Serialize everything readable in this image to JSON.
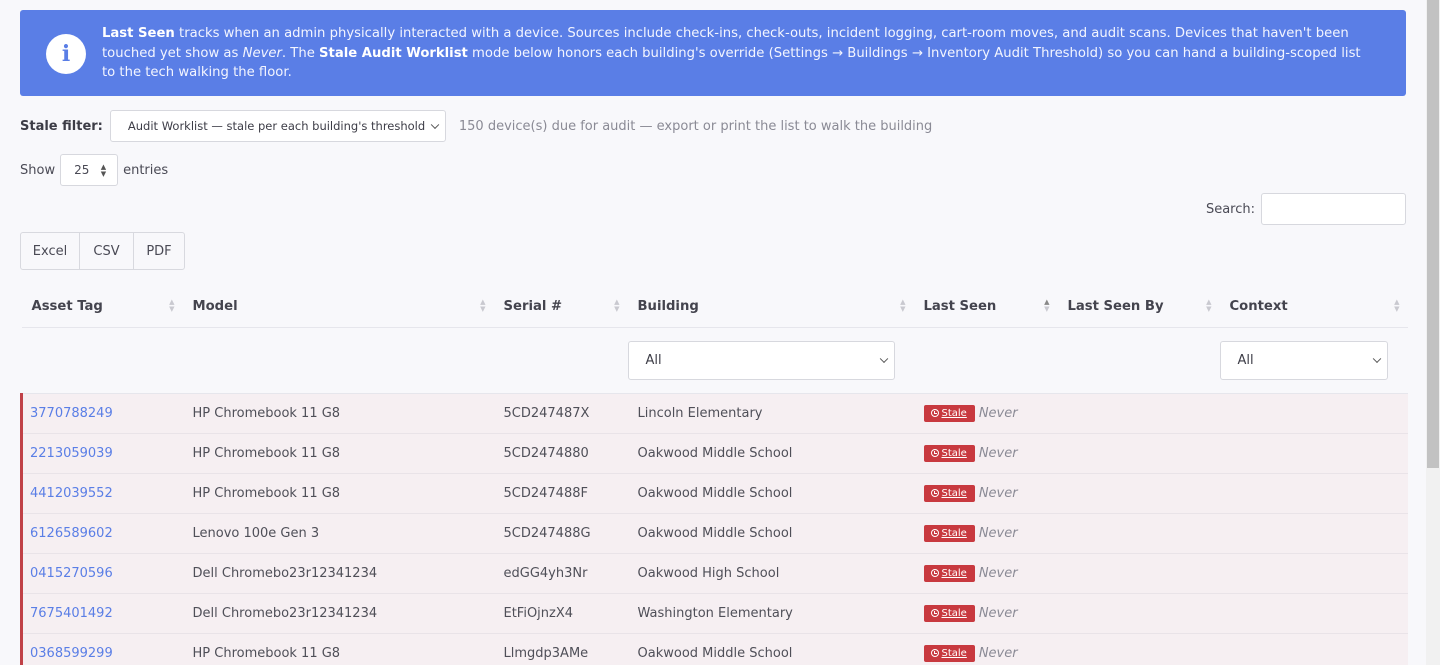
{
  "banner": {
    "icon": "info-icon",
    "bold1": "Last Seen",
    "text1": " tracks when an admin physically interacted with a device. Sources include check-ins, check-outs, incident logging, cart-room moves, and audit scans. Devices that haven't been touched yet show as ",
    "italic1": "Never",
    "text2": ". The ",
    "bold2": "Stale Audit Worklist",
    "text3": " mode below honors each building's override (Settings → Buildings → Inventory Audit Threshold) so you can hand a building-scoped list to the tech walking the floor."
  },
  "stale_filter": {
    "label": "Stale filter:",
    "selected": "Audit Worklist — stale per each building's threshold",
    "note": "150 device(s) due for audit — export or print the list to walk the building"
  },
  "length": {
    "show": "Show",
    "value": "25",
    "entries": "entries"
  },
  "search": {
    "label": "Search:"
  },
  "buttons": {
    "excel": "Excel",
    "csv": "CSV",
    "pdf": "PDF"
  },
  "table": {
    "headers": [
      "Asset Tag",
      "Model",
      "Serial #",
      "Building",
      "Last Seen",
      "Last Seen By",
      "Context"
    ],
    "building_filter": "All",
    "context_filter": "All",
    "stale_label": "Stale",
    "rows": [
      {
        "asset": "3770788249",
        "model": "HP Chromebook 11 G8",
        "serial": "5CD247487X",
        "building": "Lincoln Elementary",
        "last_seen": "Never"
      },
      {
        "asset": "2213059039",
        "model": "HP Chromebook 11 G8",
        "serial": "5CD2474880",
        "building": "Oakwood Middle School",
        "last_seen": "Never"
      },
      {
        "asset": "4412039552",
        "model": "HP Chromebook 11 G8",
        "serial": "5CD247488F",
        "building": "Oakwood Middle School",
        "last_seen": "Never"
      },
      {
        "asset": "6126589602",
        "model": "Lenovo 100e Gen 3",
        "serial": "5CD247488G",
        "building": "Oakwood Middle School",
        "last_seen": "Never"
      },
      {
        "asset": "0415270596",
        "model": "Dell Chromebo23r12341234",
        "serial": "edGG4yh3Nr",
        "building": "Oakwood High School",
        "last_seen": "Never"
      },
      {
        "asset": "7675401492",
        "model": "Dell Chromebo23r12341234",
        "serial": "EtFiOjnzX4",
        "building": "Washington Elementary",
        "last_seen": "Never"
      },
      {
        "asset": "0368599299",
        "model": "HP Chromebook 11 G8",
        "serial": "Llmgdp3AMe",
        "building": "Oakwood Middle School",
        "last_seen": "Never"
      }
    ]
  },
  "colors": {
    "accent": "#5a7ee6",
    "stale": "#c8393f"
  }
}
